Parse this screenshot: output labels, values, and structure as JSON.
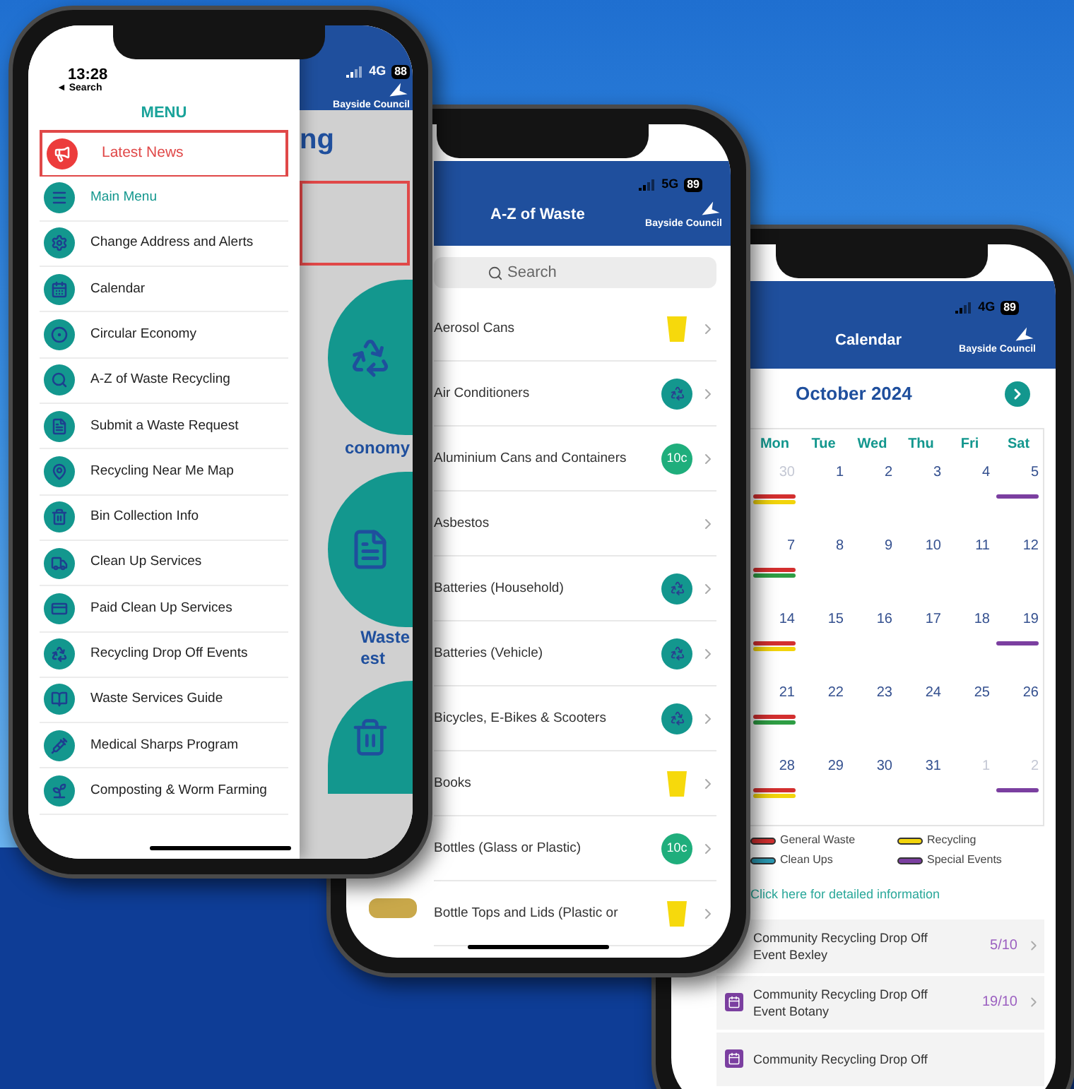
{
  "menu_screen": {
    "status": {
      "time": "13:28",
      "back": "◄ Search",
      "network": "4G",
      "battery": "88"
    },
    "title": "MENU",
    "items": [
      {
        "label": "Latest News",
        "selected": true
      },
      {
        "label": "Main Menu",
        "selected": false
      },
      {
        "label": "Change Address and Alerts",
        "selected": false
      },
      {
        "label": "Calendar",
        "selected": false
      },
      {
        "label": "Circular Economy",
        "selected": false
      },
      {
        "label": "A-Z of Waste Recycling",
        "selected": false
      },
      {
        "label": "Submit a Waste Request",
        "selected": false
      },
      {
        "label": "Recycling Near Me Map",
        "selected": false
      },
      {
        "label": "Bin Collection Info",
        "selected": false
      },
      {
        "label": "Clean Up Services",
        "selected": false
      },
      {
        "label": "Paid Clean Up Services",
        "selected": false
      },
      {
        "label": "Recycling Drop Off Events",
        "selected": false
      },
      {
        "label": "Waste Services Guide",
        "selected": false
      },
      {
        "label": "Medical Sharps Program",
        "selected": false
      },
      {
        "label": "Composting & Worm Farming",
        "selected": false
      }
    ],
    "background_page": {
      "logo": "Bayside Council",
      "heading": "ng",
      "tile_1": "conomy",
      "tile_2": "Waste\nest"
    }
  },
  "az_screen": {
    "status": {
      "network": "5G",
      "battery": "89"
    },
    "title": "A-Z of Waste",
    "logo": "Bayside Council",
    "search": {
      "placeholder": "Search"
    },
    "items": [
      {
        "label": "Aerosol Cans",
        "kind": "bin",
        "photo": false
      },
      {
        "label": "Air Conditioners",
        "kind": "dropoff",
        "photo": false
      },
      {
        "label": "Aluminium Cans and Containers",
        "kind": "deposit",
        "badge": "10c",
        "photo": false
      },
      {
        "label": "Asbestos",
        "kind": "none",
        "photo": false
      },
      {
        "label": "Batteries (Household)",
        "kind": "dropoff",
        "photo": false
      },
      {
        "label": "Batteries (Vehicle)",
        "kind": "dropoff",
        "photo": false
      },
      {
        "label": "Bicycles, E-Bikes & Scooters",
        "kind": "dropoff",
        "photo": false
      },
      {
        "label": "Books",
        "kind": "bin",
        "photo": false
      },
      {
        "label": "Bottles (Glass or Plastic)",
        "kind": "deposit",
        "badge": "10c",
        "photo": false
      },
      {
        "label": "Bottle Tops and Lids (Plastic or",
        "kind": "bin",
        "photo": true
      }
    ]
  },
  "calendar_screen": {
    "status": {
      "network": "4G",
      "battery": "89"
    },
    "title": "Calendar",
    "logo": "Bayside Council",
    "month": "October 2024",
    "weekdays": [
      "Mon",
      "Tue",
      "Wed",
      "Thu",
      "Fri",
      "Sat"
    ],
    "weeks": [
      [
        {
          "day": "30",
          "muted": true,
          "bars": [
            {
              "color": "#d32f2f"
            },
            {
              "color": "#f2d40c"
            }
          ]
        },
        {
          "day": "1",
          "muted": false
        },
        {
          "day": "2",
          "muted": false
        },
        {
          "day": "3",
          "muted": false
        },
        {
          "day": "4",
          "muted": false
        },
        {
          "day": "5",
          "muted": false,
          "bars": [
            {
              "color": "#7b3fa0"
            }
          ]
        }
      ],
      [
        {
          "day": "7",
          "muted": false,
          "bars": [
            {
              "color": "#d32f2f"
            },
            {
              "color": "#2e9e44"
            }
          ]
        },
        {
          "day": "8",
          "muted": false
        },
        {
          "day": "9",
          "muted": false
        },
        {
          "day": "10",
          "muted": false
        },
        {
          "day": "11",
          "muted": false
        },
        {
          "day": "12",
          "muted": false
        }
      ],
      [
        {
          "day": "14",
          "muted": false,
          "bars": [
            {
              "color": "#d32f2f"
            },
            {
              "color": "#f2d40c"
            }
          ]
        },
        {
          "day": "15",
          "muted": false
        },
        {
          "day": "16",
          "muted": false
        },
        {
          "day": "17",
          "muted": false
        },
        {
          "day": "18",
          "muted": false
        },
        {
          "day": "19",
          "muted": false,
          "bars": [
            {
              "color": "#7b3fa0"
            }
          ]
        }
      ],
      [
        {
          "day": "21",
          "muted": false,
          "bars": [
            {
              "color": "#d32f2f"
            },
            {
              "color": "#2e9e44"
            }
          ]
        },
        {
          "day": "22",
          "muted": false
        },
        {
          "day": "23",
          "muted": false
        },
        {
          "day": "24",
          "muted": false
        },
        {
          "day": "25",
          "muted": false
        },
        {
          "day": "26",
          "muted": false
        }
      ],
      [
        {
          "day": "28",
          "muted": false,
          "bars": [
            {
              "color": "#d32f2f"
            },
            {
              "color": "#f2d40c"
            }
          ]
        },
        {
          "day": "29",
          "muted": false
        },
        {
          "day": "30",
          "muted": false
        },
        {
          "day": "31",
          "muted": false
        },
        {
          "day": "1",
          "muted": true
        },
        {
          "day": "2",
          "muted": true,
          "bars": [
            {
              "color": "#7b3fa0"
            }
          ]
        }
      ]
    ],
    "legend": [
      {
        "label": "General Waste",
        "color": "#d32f2f"
      },
      {
        "label": "Recycling",
        "color": "#f2d40c"
      },
      {
        "label": "Clean Ups",
        "color": "#2a9bb5"
      },
      {
        "label": "Special Events",
        "color": "#7b3fa0"
      }
    ],
    "link": "Click here for detailed information",
    "events": [
      {
        "title": "Community Recycling Drop Off Event Bexley",
        "date": "5/10",
        "icon": false
      },
      {
        "title": "Community Recycling Drop Off Event Botany",
        "date": "19/10",
        "icon": true
      },
      {
        "title": "Community Recycling Drop Off",
        "icon": true
      }
    ]
  }
}
